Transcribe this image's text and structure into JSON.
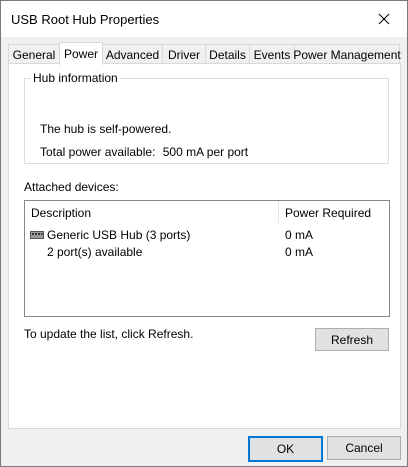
{
  "window": {
    "title": "USB Root Hub Properties"
  },
  "tabs": [
    {
      "label": "General"
    },
    {
      "label": "Power"
    },
    {
      "label": "Advanced"
    },
    {
      "label": "Driver"
    },
    {
      "label": "Details"
    },
    {
      "label": "Events"
    },
    {
      "label": "Power Management"
    }
  ],
  "active_tab": "Power",
  "hub_info": {
    "title": "Hub information",
    "powered": "The hub is self-powered.",
    "total_power_label": "Total power available:",
    "total_power_value": "500 mA per port"
  },
  "attached": {
    "label": "Attached devices:",
    "columns": {
      "description": "Description",
      "power": "Power Required"
    },
    "rows": [
      {
        "description": "Generic USB Hub (3 ports)",
        "power": "0 mA"
      },
      {
        "description": "2 port(s) available",
        "power": "0 mA"
      }
    ]
  },
  "hint": "To update the list, click Refresh.",
  "buttons": {
    "refresh": "Refresh",
    "ok": "OK",
    "cancel": "Cancel"
  },
  "icons": {
    "close": "close-icon",
    "device": "usb-hub-icon"
  },
  "colors": {
    "accent": "#0078d7"
  }
}
